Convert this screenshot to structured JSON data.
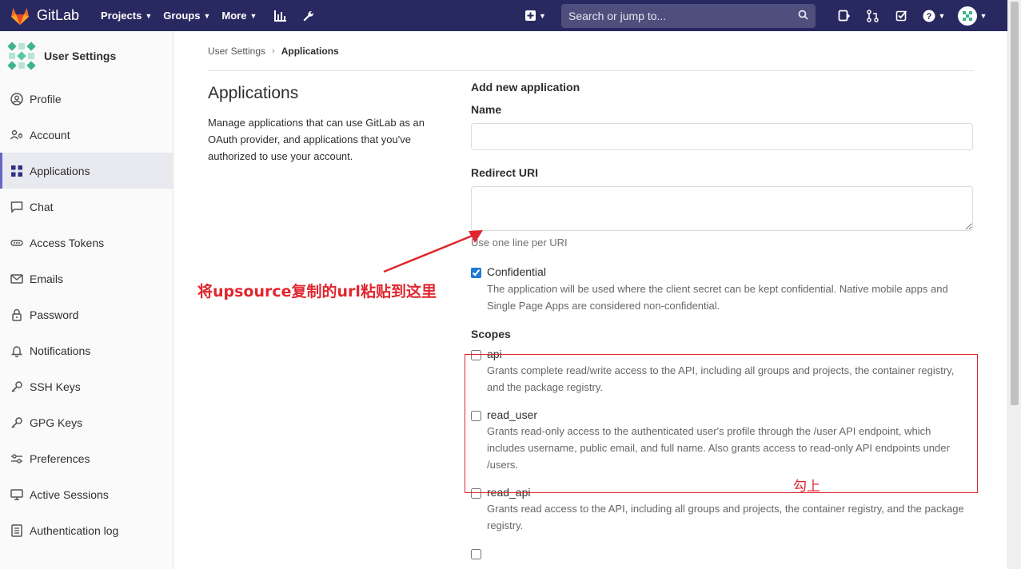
{
  "navbar": {
    "brand": "GitLab",
    "links": [
      {
        "label": "Projects"
      },
      {
        "label": "Groups"
      },
      {
        "label": "More"
      }
    ],
    "search_placeholder": "Search or jump to...",
    "colors": {
      "background": "#292961",
      "text": "#ffffff"
    }
  },
  "sidebar": {
    "title": "User Settings",
    "items": [
      {
        "label": "Profile",
        "icon": "profile-icon"
      },
      {
        "label": "Account",
        "icon": "account-icon"
      },
      {
        "label": "Applications",
        "icon": "applications-icon",
        "active": true
      },
      {
        "label": "Chat",
        "icon": "chat-icon"
      },
      {
        "label": "Access Tokens",
        "icon": "access-tokens-icon"
      },
      {
        "label": "Emails",
        "icon": "emails-icon"
      },
      {
        "label": "Password",
        "icon": "lock-icon"
      },
      {
        "label": "Notifications",
        "icon": "bell-icon"
      },
      {
        "label": "SSH Keys",
        "icon": "key-icon"
      },
      {
        "label": "GPG Keys",
        "icon": "key-icon"
      },
      {
        "label": "Preferences",
        "icon": "preferences-icon"
      },
      {
        "label": "Active Sessions",
        "icon": "monitor-icon"
      },
      {
        "label": "Authentication log",
        "icon": "log-icon"
      }
    ]
  },
  "breadcrumb": {
    "parent": "User Settings",
    "current": "Applications"
  },
  "page": {
    "title": "Applications",
    "description": "Manage applications that can use GitLab as an OAuth provider, and applications that you've authorized to use your account."
  },
  "form": {
    "heading": "Add new application",
    "name_label": "Name",
    "name_value": "",
    "redirect_label": "Redirect URI",
    "redirect_value": "",
    "redirect_help": "Use one line per URI",
    "confidential_label": "Confidential",
    "confidential_checked": true,
    "confidential_help": "The application will be used where the client secret can be kept confidential. Native mobile apps and Single Page Apps are considered non-confidential.",
    "scopes_label": "Scopes",
    "scopes": [
      {
        "name": "api",
        "checked": false,
        "description": "Grants complete read/write access to the API, including all groups and projects, the container registry, and the package registry."
      },
      {
        "name": "read_user",
        "checked": false,
        "description": "Grants read-only access to the authenticated user's profile through the /user API endpoint, which includes username, public email, and full name. Also grants access to read-only API endpoints under /users."
      },
      {
        "name": "read_api",
        "checked": false,
        "description": "Grants read access to the API, including all groups and projects, the container registry, and the package registry."
      }
    ]
  },
  "annotations": {
    "arrow_note": "将upsource复制的url粘贴到这里",
    "box_note": "勾上",
    "color": "#e0262e"
  }
}
